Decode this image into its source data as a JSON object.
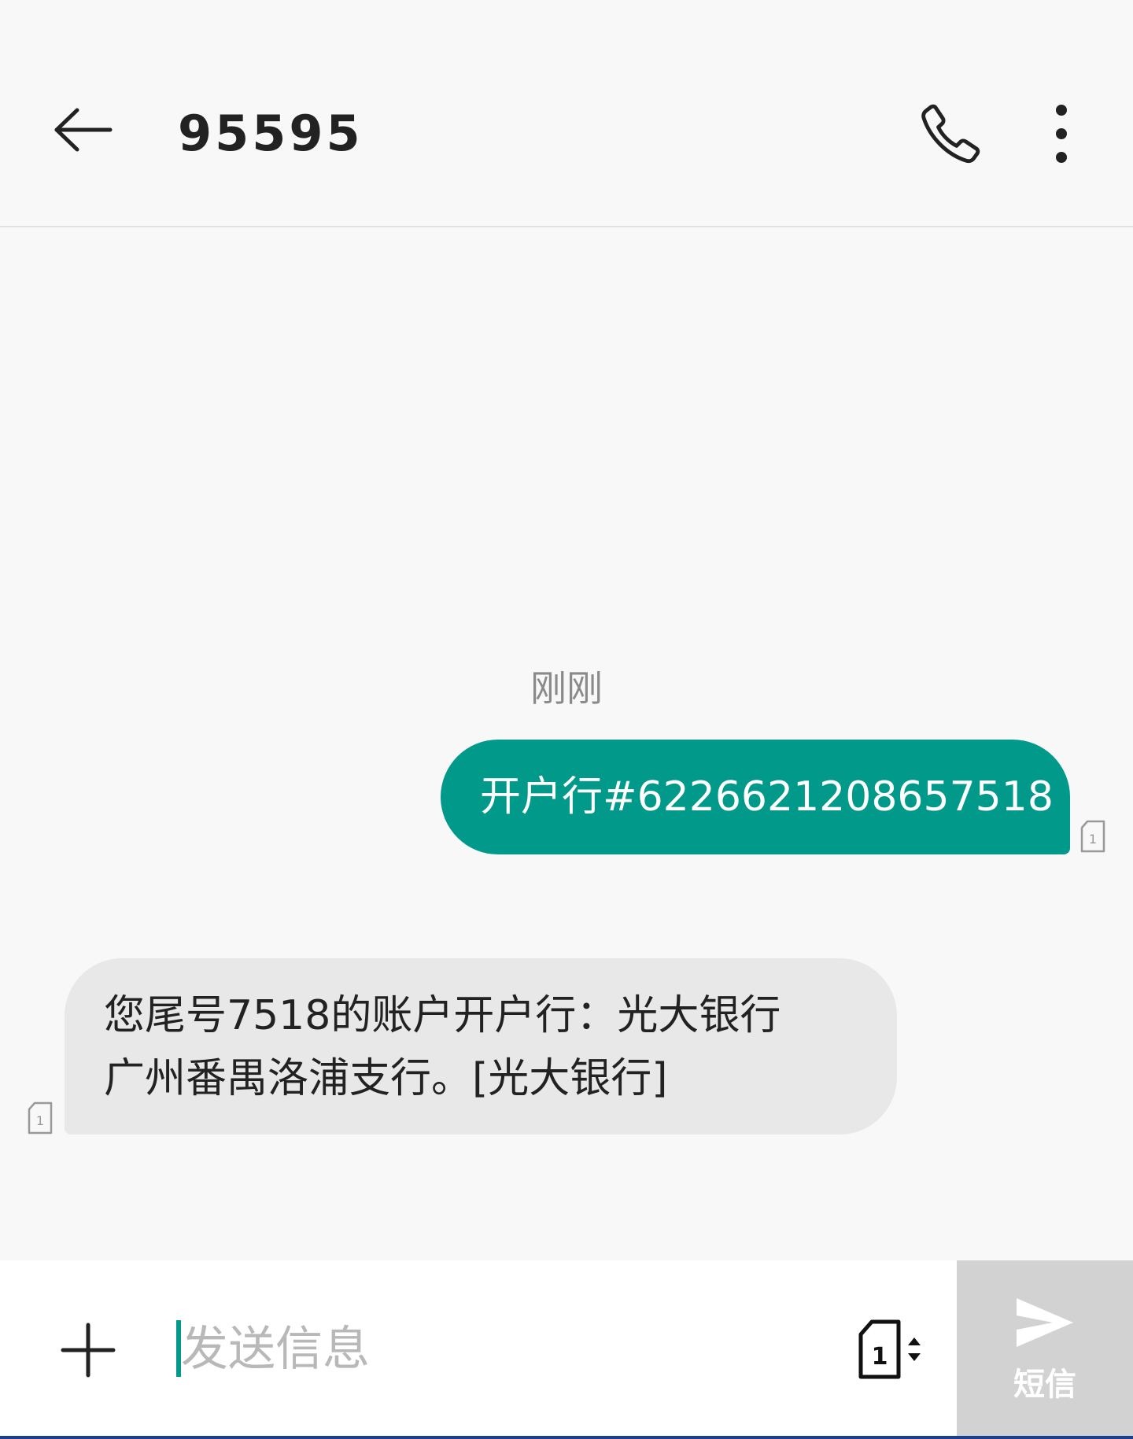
{
  "header": {
    "title": "95595",
    "back_icon": "arrow-left-icon",
    "call_icon": "phone-icon",
    "more_icon": "more-vertical-icon"
  },
  "conversation": {
    "timestamp": "刚刚",
    "messages": [
      {
        "direction": "outgoing",
        "text": "开户行#6226621208657518",
        "sim_slot": "1"
      },
      {
        "direction": "incoming",
        "lines": [
          "您尾号7518的账户开户行：光大银行",
          "广州番禺洛浦支行。[光大银行]"
        ],
        "sim_slot": "1"
      }
    ]
  },
  "composer": {
    "add_icon": "plus-icon",
    "placeholder": "发送信息",
    "value": "",
    "sim_selector": "1",
    "send_label": "短信",
    "send_icon": "send-icon"
  },
  "colors": {
    "accent": "#00998a",
    "background": "#f8f8f8",
    "incoming_bubble": "#e8e8e8",
    "send_button_disabled": "#d2d2d2"
  }
}
